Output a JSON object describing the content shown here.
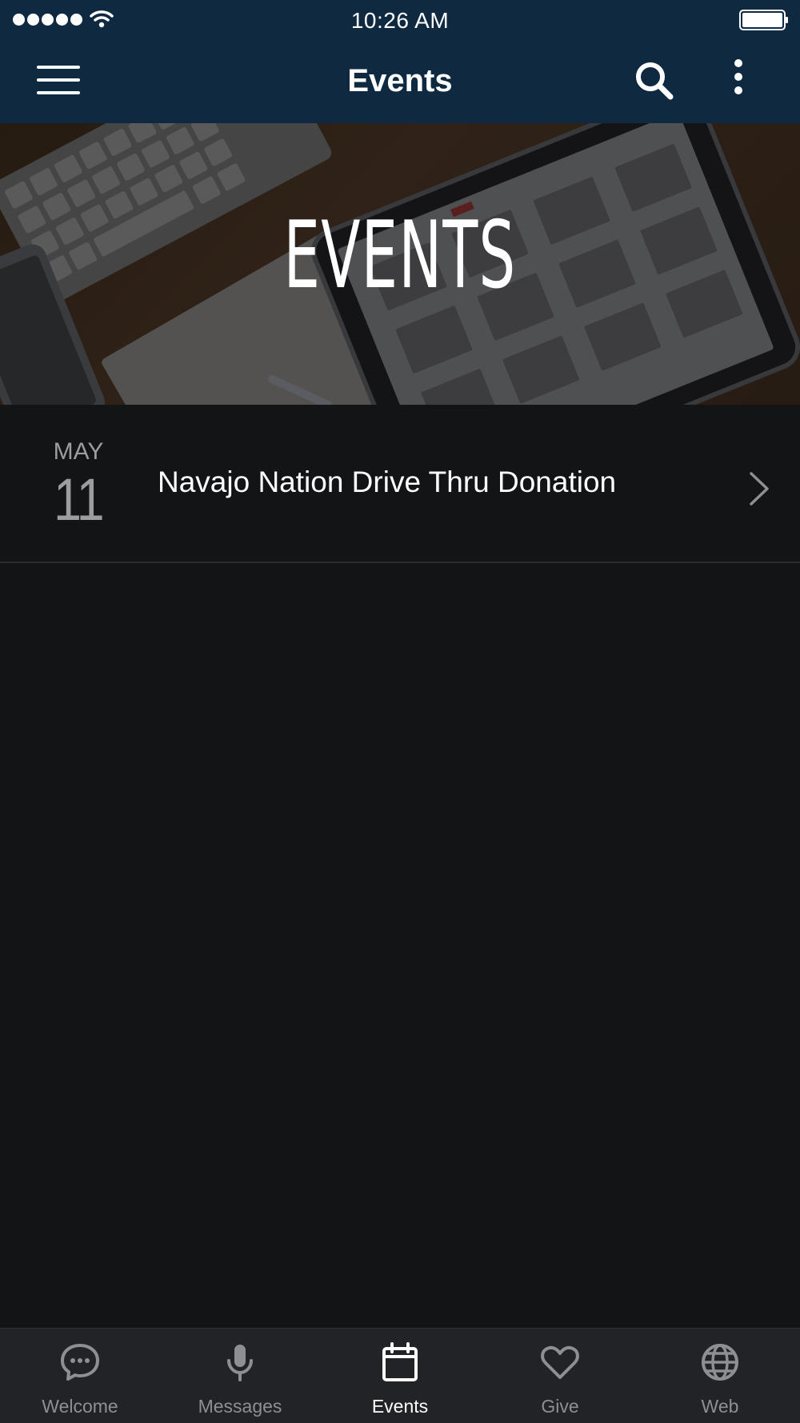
{
  "status_bar": {
    "time": "10:26 AM",
    "signal_dots": 5
  },
  "nav": {
    "title": "Events",
    "icons": [
      "menu-icon",
      "search-icon",
      "more-vertical-icon"
    ]
  },
  "hero": {
    "title": "EVENTS"
  },
  "events": [
    {
      "month": "MAY",
      "day": "11",
      "title": "Navajo Nation Drive Thru Donation"
    }
  ],
  "tabs": [
    {
      "label": "Welcome",
      "icon": "chat-bubble-icon",
      "active": false
    },
    {
      "label": "Messages",
      "icon": "microphone-icon",
      "active": false
    },
    {
      "label": "Events",
      "icon": "calendar-icon",
      "active": true
    },
    {
      "label": "Give",
      "icon": "heart-icon",
      "active": false
    },
    {
      "label": "Web",
      "icon": "globe-icon",
      "active": false
    }
  ],
  "colors": {
    "header": "#0f2941",
    "background": "#131416",
    "tab_bar": "#222326",
    "tab_inactive": "#8e8f93",
    "tab_active": "#ffffff"
  }
}
